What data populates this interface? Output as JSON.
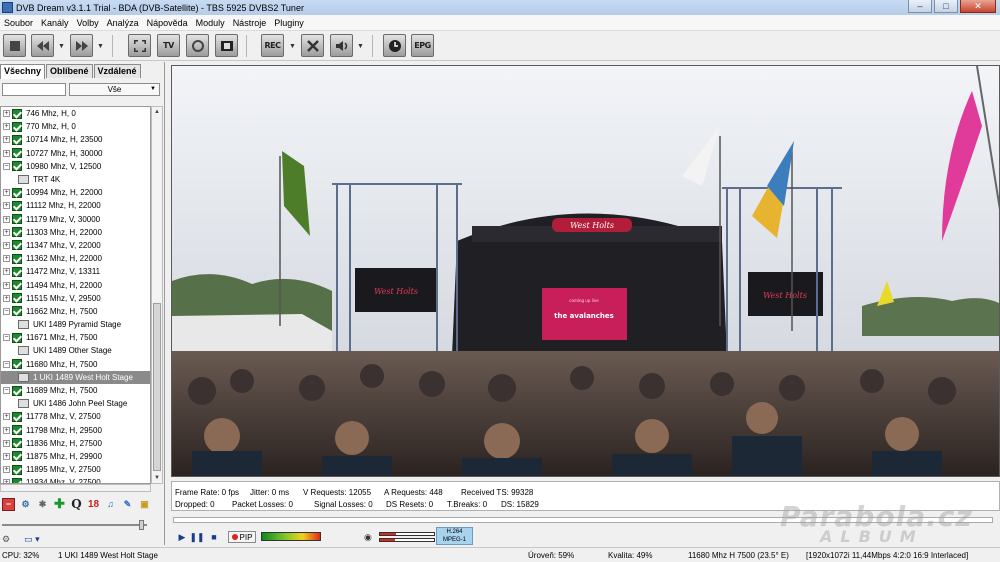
{
  "window": {
    "title": "DVB Dream v3.1.1 Trial - BDA (DVB-Satellite)    -    TBS 5925 DVBS2 Tuner"
  },
  "menu": [
    "Soubor",
    "Kanály",
    "Volby",
    "Analýza",
    "Nápověda",
    "Moduly",
    "Nástroje",
    "Pluginy"
  ],
  "toolbar": {
    "rec_label": "REC",
    "epg_label": "EPG",
    "tv_label": "TV"
  },
  "tabs": [
    "Všechny",
    "Oblíbené",
    "Vzdálené"
  ],
  "filter": {
    "value": "",
    "select": "Vše"
  },
  "channel_tree": [
    {
      "label": "746 Mhz, H, 0",
      "type": "tp",
      "exp": "+"
    },
    {
      "label": "770 Mhz, H, 0",
      "type": "tp",
      "exp": "+"
    },
    {
      "label": "10714 Mhz, H, 23500",
      "type": "tp",
      "exp": "+"
    },
    {
      "label": "10727 Mhz, H, 30000",
      "type": "tp",
      "exp": "+"
    },
    {
      "label": "10980 Mhz, V, 12500",
      "type": "tp",
      "exp": "−"
    },
    {
      "label": "TRT 4K",
      "type": "ch"
    },
    {
      "label": "10994 Mhz, H, 22000",
      "type": "tp",
      "exp": "+"
    },
    {
      "label": "11112 Mhz, H, 22000",
      "type": "tp",
      "exp": "+"
    },
    {
      "label": "11179 Mhz, V, 30000",
      "type": "tp",
      "exp": "+"
    },
    {
      "label": "11303 Mhz, H, 22000",
      "type": "tp",
      "exp": "+"
    },
    {
      "label": "11347 Mhz, V, 22000",
      "type": "tp",
      "exp": "+"
    },
    {
      "label": "11362 Mhz, H, 22000",
      "type": "tp",
      "exp": "+"
    },
    {
      "label": "11472 Mhz, V, 13311",
      "type": "tp",
      "exp": "+"
    },
    {
      "label": "11494 Mhz, H, 22000",
      "type": "tp",
      "exp": "+"
    },
    {
      "label": "11515 Mhz, V, 29500",
      "type": "tp",
      "exp": "+"
    },
    {
      "label": "11662 Mhz, H, 7500",
      "type": "tp",
      "exp": "−"
    },
    {
      "label": "UKI 1489 Pyramid Stage",
      "type": "ch"
    },
    {
      "label": "11671 Mhz, H, 7500",
      "type": "tp",
      "exp": "−"
    },
    {
      "label": "UKI 1489 Other Stage",
      "type": "ch"
    },
    {
      "label": "11680 Mhz, H, 7500",
      "type": "tp",
      "exp": "−"
    },
    {
      "label": "1 UKI 1489 West Holt Stage",
      "type": "ch",
      "selected": true
    },
    {
      "label": "11689 Mhz, H, 7500",
      "type": "tp",
      "exp": "−"
    },
    {
      "label": "UKI 1486 John Peel Stage",
      "type": "ch"
    },
    {
      "label": "11778 Mhz, V, 27500",
      "type": "tp",
      "exp": "+"
    },
    {
      "label": "11798 Mhz, H, 29500",
      "type": "tp",
      "exp": "+"
    },
    {
      "label": "11836 Mhz, H, 27500",
      "type": "tp",
      "exp": "+"
    },
    {
      "label": "11875 Mhz, H, 29900",
      "type": "tp",
      "exp": "+"
    },
    {
      "label": "11895 Mhz, V, 27500",
      "type": "tp",
      "exp": "+"
    },
    {
      "label": "11934 Mhz, V, 27500",
      "type": "tp",
      "exp": "+"
    }
  ],
  "iconrow": {
    "q_label": "Q",
    "age_label": "18"
  },
  "stats": {
    "frame_rate": "Frame Rate: 0 fps",
    "jitter": "Jitter: 0 ms",
    "v_requests": "V Requests: 12055",
    "a_requests": "A Requests: 448",
    "received_ts": "Received TS: 99328",
    "dropped": "Dropped: 0",
    "packet_losses": "Packet Losses: 0",
    "signal_losses": "Signal Losses: 0",
    "ds_resets": "DS Resets: 0",
    "t_breaks": "T.Breaks: 0",
    "ds": "DS: 15829"
  },
  "controls": {
    "pip_label": "PIP",
    "video_codec": "H.264",
    "audio_codec": "MPEG-1",
    "audio_level": 0.3
  },
  "stage_banner": {
    "sign": "West Holts",
    "screen_title": "the avalanches",
    "screen_sub": "coming up live",
    "side_left": "West Holts",
    "side_right": "West Holts"
  },
  "status": {
    "cpu": "CPU: 32%",
    "channel": "1 UKI 1489 West Holt Stage",
    "level": "Úroveň: 59%",
    "quality": "Kvalita: 49%",
    "tp": "11680 Mhz  H  7500    (23.5° E)",
    "format": "[1920x1072i 11,44Mbps 4:2:0  16:9 Interlaced]"
  },
  "watermark": {
    "main": "Parabola.cz",
    "sub": "ALBUM"
  },
  "colors": {
    "accent": "#1c8a2c",
    "selected_row": "#8a8a8a",
    "codec_badge": "#a8d2ee"
  }
}
